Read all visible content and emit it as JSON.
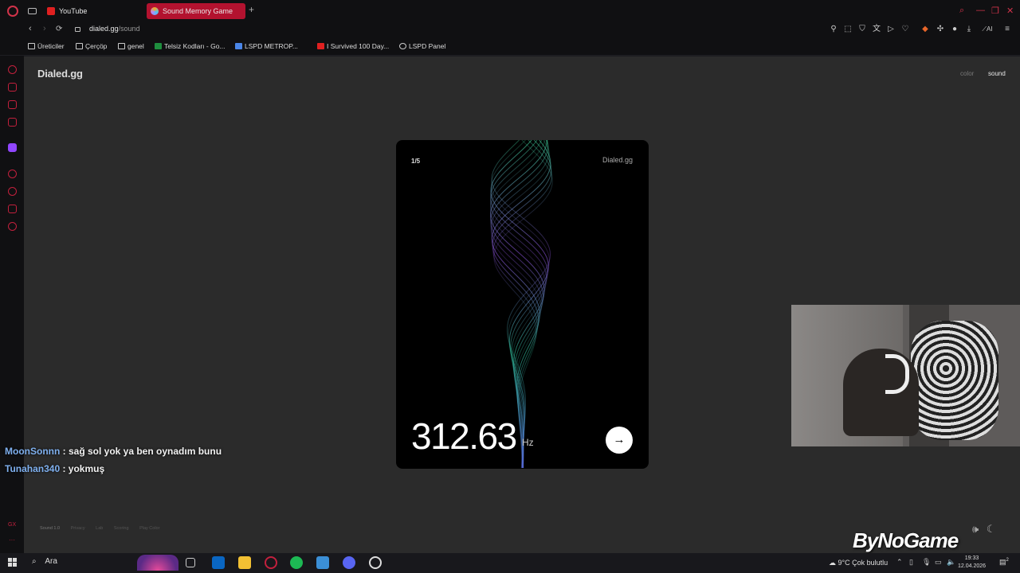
{
  "tabs": [
    {
      "label": "YouTube",
      "active": false,
      "favicon": "youtube-icon"
    },
    {
      "label": "Sound Memory Game",
      "active": true,
      "favicon": "speaker-icon"
    }
  ],
  "address": {
    "host": "dialed.gg",
    "path": "/sound"
  },
  "bookmarks": [
    {
      "label": "Üreticiler",
      "icon": "folder-icon"
    },
    {
      "label": "Çerçöp",
      "icon": "folder-icon"
    },
    {
      "label": "genel",
      "icon": "folder-icon"
    },
    {
      "label": "Telsiz Kodları - Go...",
      "icon": "sheets-icon"
    },
    {
      "label": "LSPD METROP...",
      "icon": "docs-icon"
    },
    {
      "label": "I Survived 100 Day...",
      "icon": "youtube-icon"
    },
    {
      "label": "LSPD Panel",
      "icon": "globe-icon"
    }
  ],
  "site": {
    "logo": "Dialed.gg",
    "nav": {
      "color": "color",
      "sound": "sound"
    }
  },
  "card": {
    "progress": "1/5",
    "brand": "Dialed.gg",
    "frequency": "312.63",
    "unit": "Hz",
    "next_icon": "→"
  },
  "footer": {
    "links": [
      "Sound 1.0",
      "Privacy",
      "Lab",
      "Scoring",
      "Play Color"
    ]
  },
  "chat": [
    {
      "user": "MoonSonnn",
      "message": " : sağ sol yok ya ben oynadım bunu"
    },
    {
      "user": "Tunahan340",
      "message": " : yokmuş"
    }
  ],
  "watermark": "ByNoGame",
  "taskbar": {
    "search": "Ara",
    "weather": "9°C  Çok bulutlu",
    "time": "19:33",
    "date": "12.04.2026",
    "notifications": "2"
  },
  "colors": {
    "accent": "#c3203d",
    "card_bg": "#000000",
    "page_bg": "#2b2b2b"
  }
}
